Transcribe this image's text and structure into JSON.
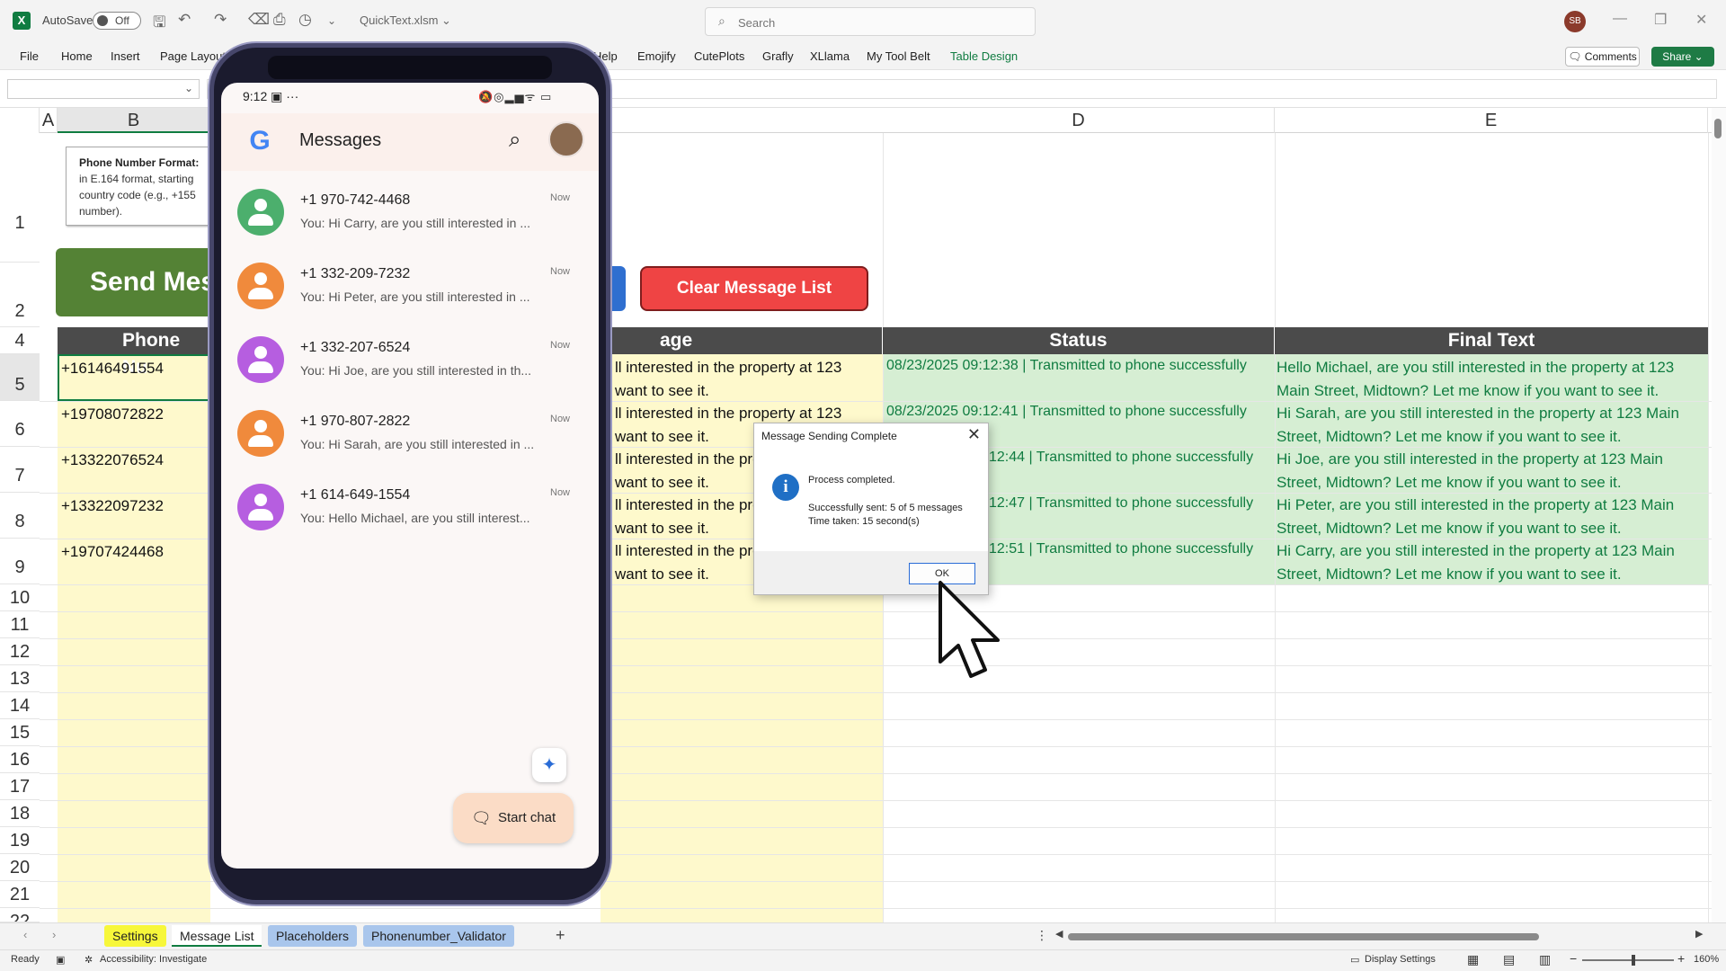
{
  "titlebar": {
    "autosave_label": "AutoSave",
    "autosave_state": "Off",
    "doc_title": "QuickText.xlsm ⌄",
    "search_placeholder": "Search",
    "user_initials": "SB"
  },
  "menu": {
    "items": [
      "File",
      "Home",
      "Insert",
      "Page Layout",
      "Help",
      "Emojify",
      "CutePlots",
      "Grafly",
      "XLlama",
      "My Tool Belt",
      "Table Design"
    ],
    "comments": "Comments",
    "share": "Share ⌄"
  },
  "sheet": {
    "columns": [
      "A",
      "B",
      "D",
      "E"
    ],
    "rows": [
      "1",
      "2",
      "4",
      "5",
      "6",
      "7",
      "8",
      "9",
      "10",
      "11",
      "12",
      "13",
      "14",
      "15",
      "16",
      "17",
      "18",
      "19",
      "20",
      "21",
      "22"
    ],
    "info_title": "Phone Number Format:",
    "info_body": "in E.164 format, starting country code (e.g., +155 number).",
    "send_button": "Send Mes",
    "clear_button": "Clear Message List",
    "headers": {
      "phone": "Phone Nu",
      "message": "age",
      "status": "Status",
      "final": "Final Text"
    },
    "rows_data": [
      {
        "phone": "+16146491554",
        "msg1": "ll interested in the property at 123",
        "msg2": "want to see it.",
        "status": "08/23/2025 09:12:38 | Transmitted to phone successfully",
        "final": "Hello Michael, are you still interested in the property at 123 Main Street, Midtown? Let me know if you want to see it."
      },
      {
        "phone": "+19708072822",
        "msg1": "ll interested in the property at 123",
        "msg2": "want to see it.",
        "status": "08/23/2025 09:12:41 | Transmitted to phone successfully",
        "final": "Hi Sarah, are you still interested in the property at 123 Main Street, Midtown? Let me know if you want to see it."
      },
      {
        "phone": "+13322076524",
        "msg1": "ll interested in the pro",
        "msg2": "want to see it.",
        "status": "12:44 | Transmitted to phone successfully",
        "final": "Hi Joe, are you still interested in the property at 123 Main Street, Midtown? Let me know if you want to see it."
      },
      {
        "phone": "+13322097232",
        "msg1": "ll interested in the pro",
        "msg2": "want to see it.",
        "status": "12:47 | Transmitted to phone successfully",
        "final": "Hi Peter, are you still interested in the property at 123 Main Street, Midtown? Let me know if you want to see it."
      },
      {
        "phone": "+19707424468",
        "msg1": "ll interested in the pro",
        "msg2": "want to see it.",
        "status": "12:51 | Transmitted to phone successfully",
        "final": "Hi Carry, are you still interested in the property at 123 Main Street, Midtown? Let me know if you want to see it."
      }
    ]
  },
  "phone": {
    "time": "9:12",
    "status_extra": "▣ ···",
    "status_icons": "🔕◎▂▅ᯤ ▭",
    "app_title": "Messages",
    "conversations": [
      {
        "number": "+1 970-742-4468",
        "preview": "You: Hi Carry, are you still interested in ...",
        "time": "Now",
        "color": "#4caf6d"
      },
      {
        "number": "+1 332-209-7232",
        "preview": "You: Hi Peter, are you still interested in ...",
        "time": "Now",
        "color": "#f08a3c"
      },
      {
        "number": "+1 332-207-6524",
        "preview": "You: Hi Joe, are you still interested in th...",
        "time": "Now",
        "color": "#b65ee0"
      },
      {
        "number": "+1 970-807-2822",
        "preview": "You: Hi Sarah, are you still interested in ...",
        "time": "Now",
        "color": "#f08a3c"
      },
      {
        "number": "+1 614-649-1554",
        "preview": "You: Hello Michael, are you still interest...",
        "time": "Now",
        "color": "#b65ee0"
      }
    ],
    "start_chat": "Start chat"
  },
  "dialog": {
    "title": "Message Sending Complete",
    "line1": "Process completed.",
    "line2": "Successfully sent: 5 of 5 messages",
    "line3": "Time taken: 15 second(s)",
    "ok": "OK"
  },
  "tabs": [
    "Settings",
    "Message List",
    "Placeholders",
    "Phonenumber_Validator"
  ],
  "tab_colors": [
    "#f7f73a",
    "#ffffff",
    "#a9c6ec",
    "#a9c6ec"
  ],
  "statusbar": {
    "ready": "Ready",
    "accessibility": "Accessibility: Investigate",
    "display_settings": "Display Settings",
    "zoom": "160%"
  }
}
